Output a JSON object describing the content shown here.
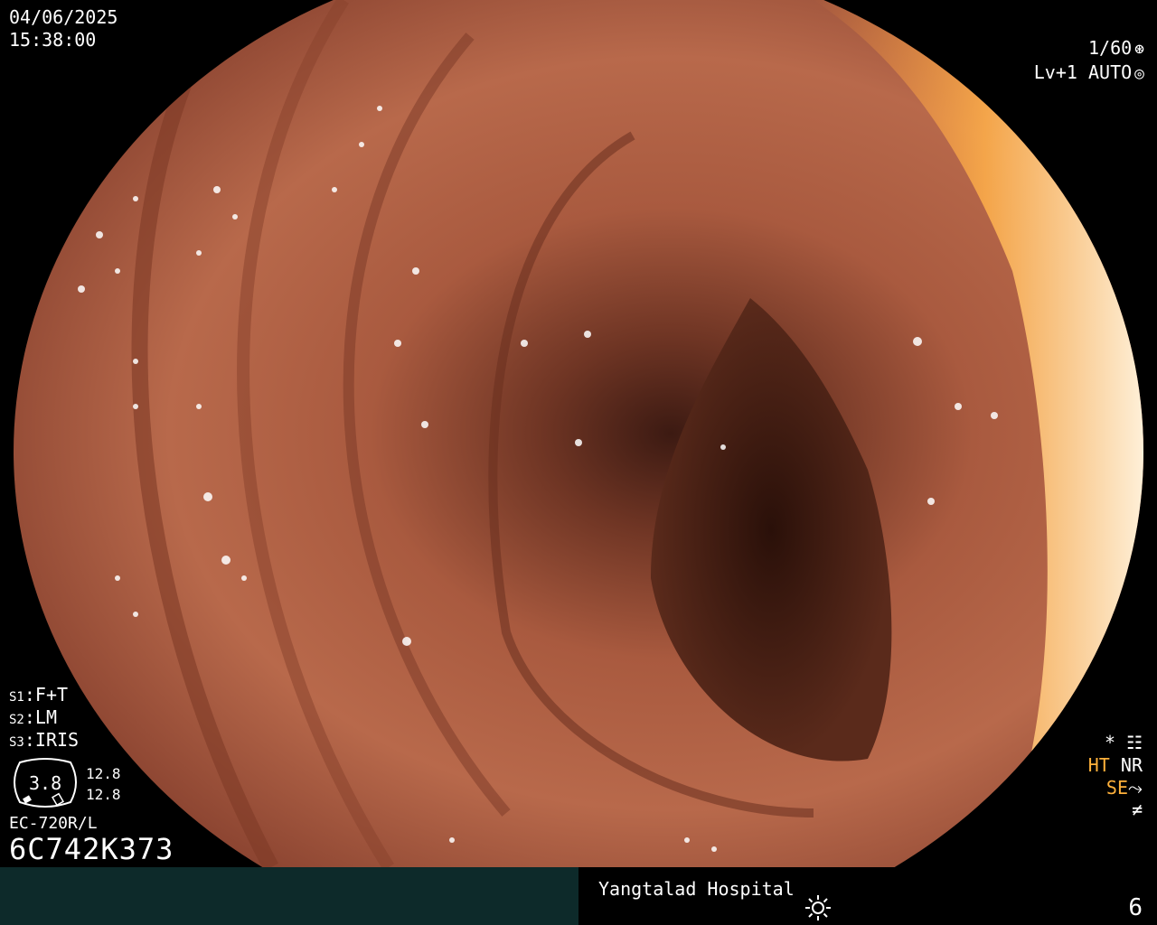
{
  "overlay": {
    "date": "04/06/2025",
    "time": "15:38:00",
    "shutter": "1/60",
    "shutter_icon": "aperture-icon",
    "level": "Lv+1",
    "exposure_mode": "AUTO",
    "exposure_icon": "iris-icon",
    "settings": [
      {
        "key": "S1",
        "value": "F+T"
      },
      {
        "key": "S2",
        "value": "LM"
      },
      {
        "key": "S3",
        "value": "IRIS"
      }
    ],
    "gauge_value": "3.8",
    "gauge_right_1": "12.8",
    "gauge_right_2": "12.8",
    "scope_model": "EC-720R/L",
    "scope_serial": "6C742K373",
    "indicators": {
      "star": "*",
      "ht": "HT",
      "nr": "NR",
      "se": "SE"
    },
    "hospital": "Yangtalad Hospital",
    "page_number": "6",
    "colors": {
      "accent_orange": "#ffb13b",
      "bottom_bar_left": "#0d2a2a"
    }
  }
}
